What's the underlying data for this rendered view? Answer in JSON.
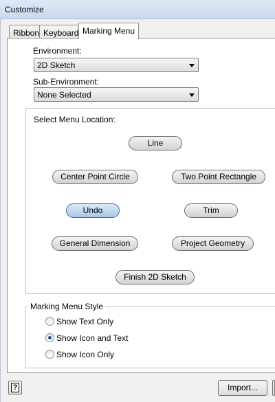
{
  "window": {
    "title": "Customize"
  },
  "tabs": [
    {
      "label": "Ribbon"
    },
    {
      "label": "Keyboard"
    },
    {
      "label": "Marking Menu"
    }
  ],
  "environment": {
    "label": "Environment:",
    "value": "2D Sketch"
  },
  "sub_environment": {
    "label": "Sub-Environment:",
    "value": "None Selected"
  },
  "menu_location": {
    "label": "Select Menu Location:",
    "items": {
      "line": "Line",
      "center_point_circle": "Center Point Circle",
      "two_point_rectangle": "Two Point Rectangle",
      "undo": "Undo",
      "trim": "Trim",
      "general_dimension": "General Dimension",
      "project_geometry": "Project Geometry",
      "finish_2d_sketch": "Finish 2D Sketch"
    },
    "selected": "Undo"
  },
  "style": {
    "label": "Marking Menu Style",
    "options": [
      {
        "label": "Show Text Only",
        "checked": false
      },
      {
        "label": "Show Icon and Text",
        "checked": true
      },
      {
        "label": "Show Icon Only",
        "checked": false
      }
    ]
  },
  "footer": {
    "help_icon": "help-icon",
    "import_label": "Import..."
  }
}
